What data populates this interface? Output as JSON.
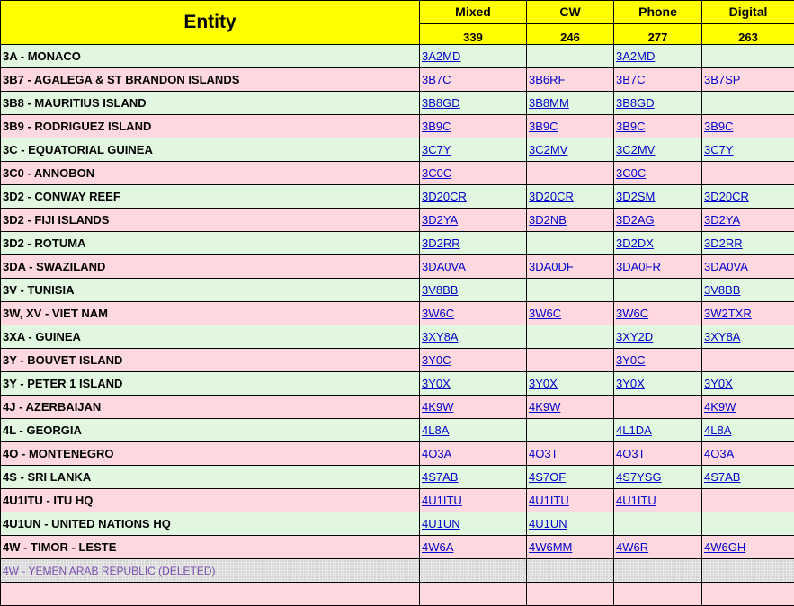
{
  "header": {
    "entity_label": "Entity",
    "modes": [
      {
        "label": "Mixed",
        "count": "339"
      },
      {
        "label": "CW",
        "count": "246"
      },
      {
        "label": "Phone",
        "count": "277"
      },
      {
        "label": "Digital",
        "count": "263"
      }
    ]
  },
  "rows": [
    {
      "entity": "3A - MONACO",
      "mixed": "3A2MD",
      "cw": "",
      "phone": "3A2MD",
      "digital": "",
      "color": "green"
    },
    {
      "entity": "3B7 - AGALEGA & ST BRANDON ISLANDS",
      "mixed": "3B7C",
      "cw": "3B6RF",
      "phone": "3B7C",
      "digital": "3B7SP",
      "color": "pink"
    },
    {
      "entity": "3B8 - MAURITIUS ISLAND",
      "mixed": "3B8GD",
      "cw": "3B8MM",
      "phone": "3B8GD",
      "digital": "",
      "color": "green"
    },
    {
      "entity": "3B9 - RODRIGUEZ ISLAND",
      "mixed": "3B9C",
      "cw": "3B9C",
      "phone": "3B9C",
      "digital": "3B9C",
      "color": "pink"
    },
    {
      "entity": "3C - EQUATORIAL GUINEA",
      "mixed": "3C7Y",
      "cw": "3C2MV",
      "phone": "3C2MV",
      "digital": "3C7Y",
      "color": "green"
    },
    {
      "entity": "3C0 - ANNOBON",
      "mixed": "3C0C",
      "cw": "",
      "phone": "3C0C",
      "digital": "",
      "color": "pink"
    },
    {
      "entity": "3D2 - CONWAY REEF",
      "mixed": "3D20CR",
      "cw": "3D20CR",
      "phone": "3D2SM",
      "digital": "3D20CR",
      "color": "green"
    },
    {
      "entity": "3D2 - FIJI ISLANDS",
      "mixed": "3D2YA",
      "cw": "3D2NB",
      "phone": "3D2AG",
      "digital": "3D2YA",
      "color": "pink"
    },
    {
      "entity": "3D2 - ROTUMA",
      "mixed": "3D2RR",
      "cw": "",
      "phone": "3D2DX",
      "digital": "3D2RR",
      "color": "green"
    },
    {
      "entity": "3DA - SWAZILAND",
      "mixed": "3DA0VA",
      "cw": "3DA0DF",
      "phone": "3DA0FR",
      "digital": "3DA0VA",
      "color": "pink"
    },
    {
      "entity": "3V - TUNISIA",
      "mixed": "3V8BB",
      "cw": "",
      "phone": "",
      "digital": "3V8BB",
      "color": "green"
    },
    {
      "entity": "3W, XV - VIET NAM",
      "mixed": "3W6C",
      "cw": "3W6C",
      "phone": "3W6C",
      "digital": "3W2TXR",
      "color": "pink"
    },
    {
      "entity": "3XA - GUINEA",
      "mixed": "3XY8A",
      "cw": "",
      "phone": "3XY2D",
      "digital": "3XY8A",
      "color": "green"
    },
    {
      "entity": "3Y - BOUVET ISLAND",
      "mixed": "3Y0C",
      "cw": "",
      "phone": "3Y0C",
      "digital": "",
      "color": "pink"
    },
    {
      "entity": "3Y - PETER 1 ISLAND",
      "mixed": "3Y0X",
      "cw": "3Y0X",
      "phone": "3Y0X",
      "digital": "3Y0X",
      "color": "green"
    },
    {
      "entity": "4J - AZERBAIJAN",
      "mixed": "4K9W",
      "cw": "4K9W",
      "phone": "",
      "digital": "4K9W",
      "color": "pink"
    },
    {
      "entity": "4L - GEORGIA",
      "mixed": "4L8A",
      "cw": "",
      "phone": "4L1DA",
      "digital": "4L8A",
      "color": "green"
    },
    {
      "entity": "4O - MONTENEGRO",
      "mixed": "4O3A",
      "cw": "4O3T",
      "phone": "4O3T",
      "digital": "4O3A",
      "color": "pink"
    },
    {
      "entity": "4S - SRI LANKA",
      "mixed": "4S7AB",
      "cw": "4S7OF",
      "phone": "4S7YSG",
      "digital": "4S7AB",
      "color": "green"
    },
    {
      "entity": "4U1ITU - ITU HQ",
      "mixed": "4U1ITU",
      "cw": "4U1ITU",
      "phone": "4U1ITU",
      "digital": "",
      "color": "pink"
    },
    {
      "entity": "4U1UN - UNITED NATIONS HQ",
      "mixed": "4U1UN",
      "cw": "4U1UN",
      "phone": "",
      "digital": "",
      "color": "green"
    },
    {
      "entity": "4W - TIMOR - LESTE",
      "mixed": "4W6A",
      "cw": "4W6MM",
      "phone": "4W6R",
      "digital": "4W6GH",
      "color": "pink"
    }
  ],
  "deleted_row": {
    "entity": "4W - YEMEN ARAB REPUBLIC (DELETED)"
  },
  "colors": {
    "header": "#ffff00",
    "green_row": "#e1f7df",
    "pink_row": "#ffd9df",
    "link": "#0000cc",
    "deleted_text": "#7a4fb0"
  }
}
